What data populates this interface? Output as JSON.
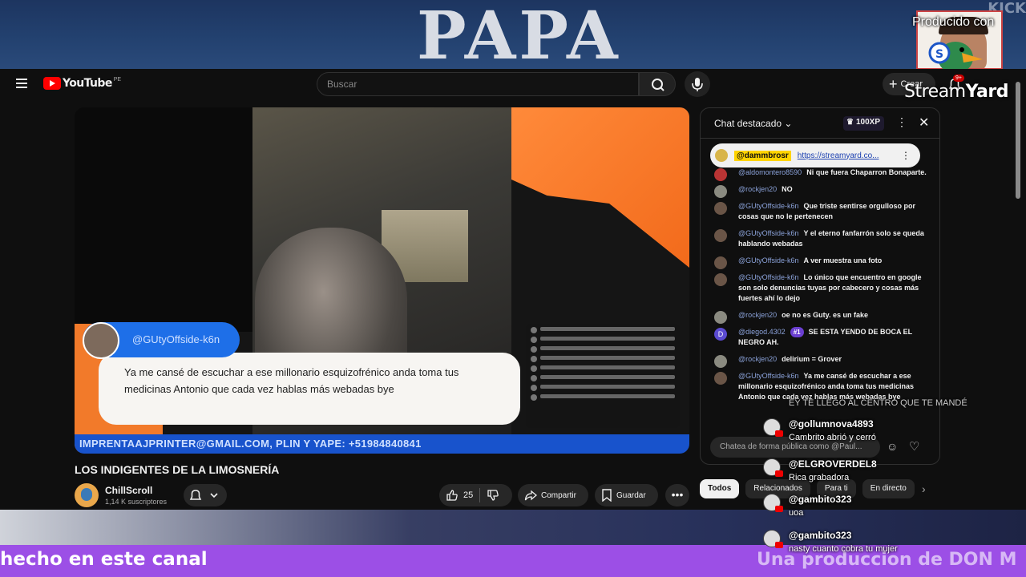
{
  "background_top": {
    "headline_word": "PAPA",
    "corner_word": "KICK",
    "produced_label": "Producido con",
    "streamyard_logo": {
      "part1": "Stream",
      "part2": "Yard"
    }
  },
  "youtube": {
    "logo_word": "YouTube",
    "region": "PE",
    "search_placeholder": "Buscar",
    "create_label": "Crear",
    "notification_count": "9+"
  },
  "video": {
    "overlay_name": "@GUtyOffside-k6n",
    "overlay_comment": "Ya me cansé de escuchar a ese millonario esquizofrénico anda toma tus medicinas Antonio que cada vez hablas más webadas bye",
    "ticker": "IMPRENTAAJPRINTER@GMAIL.COM, PLIN Y YAPE: +51984840841",
    "title": "LOS INDIGENTES DE LA LIMOSNERÍA",
    "channel_name": "ChillScroll",
    "subscribers": "1,14 K suscriptores",
    "likes": "25",
    "share_label": "Compartir",
    "save_label": "Guardar"
  },
  "chat": {
    "title": "Chat destacado",
    "xp": "100XP",
    "pinned": {
      "user": "@dammbrosr",
      "link": "https://streamyard.co..."
    },
    "messages": [
      {
        "author": "@aldomontero8590",
        "text": "Ni que fuera Chaparron Bonaparte.",
        "avatar": "red"
      },
      {
        "author": "@rockjen20",
        "text": "NO",
        "avatar": "grey"
      },
      {
        "author": "@GUtyOffside-k6n",
        "text": "Que triste sentirse orgulloso por cosas que no le pertenecen",
        "avatar": "brown"
      },
      {
        "author": "@GUtyOffside-k6n",
        "text": "Y el eterno fanfarrón solo se queda hablando webadas",
        "avatar": "brown"
      },
      {
        "author": "@GUtyOffside-k6n",
        "text": "A ver muestra una foto",
        "avatar": "brown"
      },
      {
        "author": "@GUtyOffside-k6n",
        "text": "Lo único que encuentro en google son solo denuncias tuyas por cabecero y cosas más fuertes ahí lo dejo",
        "avatar": "brown"
      },
      {
        "author": "@rockjen20",
        "text": "oe no es Guty. es un fake",
        "avatar": "grey"
      },
      {
        "author": "@diegod.4302",
        "rank": "#1",
        "text": "SE ESTA YENDO DE BOCA EL NEGRO AH.",
        "avatar": "purple",
        "initial": "D"
      },
      {
        "author": "@rockjen20",
        "text": "delirium = Grover",
        "avatar": "grey"
      },
      {
        "author": "@GUtyOffside-k6n",
        "text": "Ya me cansé de escuchar a ese millonario esquizofrénico anda toma tus medicinas Antonio que cada vez hablas más webadas bye",
        "avatar": "brown"
      }
    ],
    "input_placeholder": "Chatea de forma pública como @Paul..."
  },
  "chips": [
    "Todos",
    "Relacionados",
    "Para ti",
    "En directo"
  ],
  "stream_overlay": {
    "header_text": "EY TE LLEGO AL CENTRO QUE TE MANDÉ",
    "comments": [
      {
        "user": "@gollumnova4893",
        "text": "Cambrito abrió y cerró"
      },
      {
        "user": "@ELGROVERDEL8",
        "text": "Rica grabadora"
      },
      {
        "user": "@gambito323",
        "text": "uoa"
      },
      {
        "user": "@gambito323",
        "text": "nasty cuanto cobra tu mujer"
      }
    ],
    "banner_left": "hecho en este canal",
    "banner_right": "Una produccion de DON M"
  }
}
